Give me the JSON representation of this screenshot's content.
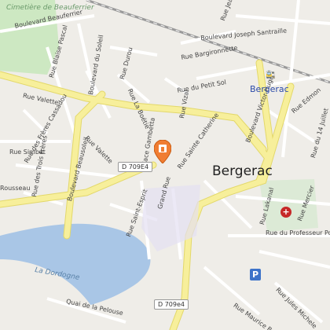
{
  "map": {
    "city_label": "Bergerac",
    "district_label": "Cimetière de Beauferrier",
    "river_label": "La Dordogne",
    "station_label": "Bergerac",
    "road_shields": [
      "D 709E4",
      "D 709e4"
    ],
    "streets": {
      "boulevard_beauferrier": "Boulevard Beauferrier",
      "rue_blaise_pascal": "Rue Blaise Pascal",
      "boulevard_du_soleil": "Boulevard du Soleil",
      "rue_valette_upper": "Rue Valette",
      "rue_valette_mid": "Rue Valette",
      "rue_freres_cassadou": "Rue des Frères Cassadou",
      "rue_simbat": "Rue Simbat",
      "rue_des_trois_freres": "Rue des Trois Frères",
      "boulevard_beausoleil": "Boulevard Beausoleil",
      "rue_rousseau": "Rousseau",
      "rue_durou": "Rue Durou",
      "rue_la_boetie": "Rue La Boétie",
      "place_gambetta": "Place Gambetta",
      "rue_du_petit_sol": "Rue du Petit Sol",
      "rue_vizal": "Rue Vizal",
      "rue_sainte_catherine": "Rue Sainte Catherine",
      "rue_bargironnette": "Rue Bargironnette",
      "boulevard_joseph_santraille": "Boulevard Joseph Santraille",
      "rue_jean_nic": "Rue Jean Ni",
      "boulevard_victor_hugo": "Boulevard Victor Hugo",
      "rue_edmond": "Rue Edmon",
      "rue_du_14_juillet": "Rue du 14 Juillet",
      "rue_lakanal": "Rue Lakanal",
      "rue_mercier": "Rue Mercier",
      "rue_professeur_pozzi": "Rue du Professeur Pozzi",
      "rue_saint_esprit": "Rue Saint-Esprit",
      "grand_rue": "Grand Rue",
      "quai_de_la_pelouse": "Quai de la Pelouse",
      "rue_jules_michelet": "Rue Jules Michele",
      "rue_maurice_barres": "Rue Maurice Barrès"
    }
  },
  "colors": {
    "background": "#efede8",
    "water": "#a9c6e6",
    "major_road": "#f7ef9b",
    "road": "#ffffff",
    "green": "#cde8c2",
    "marker": "#f07d32"
  },
  "icons": {
    "location_marker": "map-pin-icon",
    "hospital": "hospital-icon",
    "parking": "parking-icon",
    "train_station": "train-station-icon"
  }
}
